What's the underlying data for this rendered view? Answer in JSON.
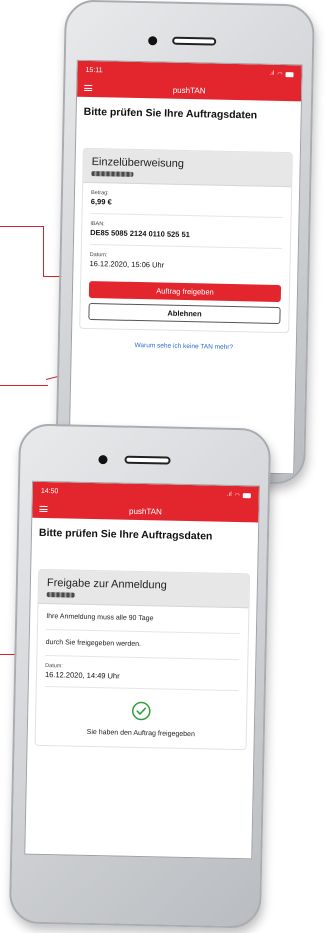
{
  "phone1": {
    "time": "15:11",
    "app_title": "pushTAN",
    "heading": "Bitte prüfen Sie Ihre Auftragsdaten",
    "card_title": "Einzelüberweisung",
    "fields": [
      {
        "label": "Betrag:",
        "value": "6,99 €"
      },
      {
        "label": "IBAN:",
        "value": "DE85 5085 2124 0110 525 51"
      },
      {
        "label": "Datum:",
        "value": "16.12.2020, 15:06 Uhr"
      }
    ],
    "approve_label": "Auftrag freigeben",
    "reject_label": "Ablehnen",
    "help_link": "Warum sehe ich keine TAN mehr?"
  },
  "phone2": {
    "time": "14:50",
    "app_title": "pushTAN",
    "heading": "Bitte prüfen Sie Ihre Auftragsdaten",
    "card_title": "Freigabe zur Anmeldung",
    "message_1": "Ihre Anmeldung muss alle 90 Tage",
    "message_2": "durch Sie freigegeben werden.",
    "date_label": "Datum:",
    "date_value": "16.12.2020, 14:49 Uhr",
    "success_text": "Sie haben den Auftrag freigegeben"
  },
  "colors": {
    "brand_red": "#e3262e",
    "link_blue": "#2a6fc4",
    "success_green": "#2e9e3a"
  }
}
